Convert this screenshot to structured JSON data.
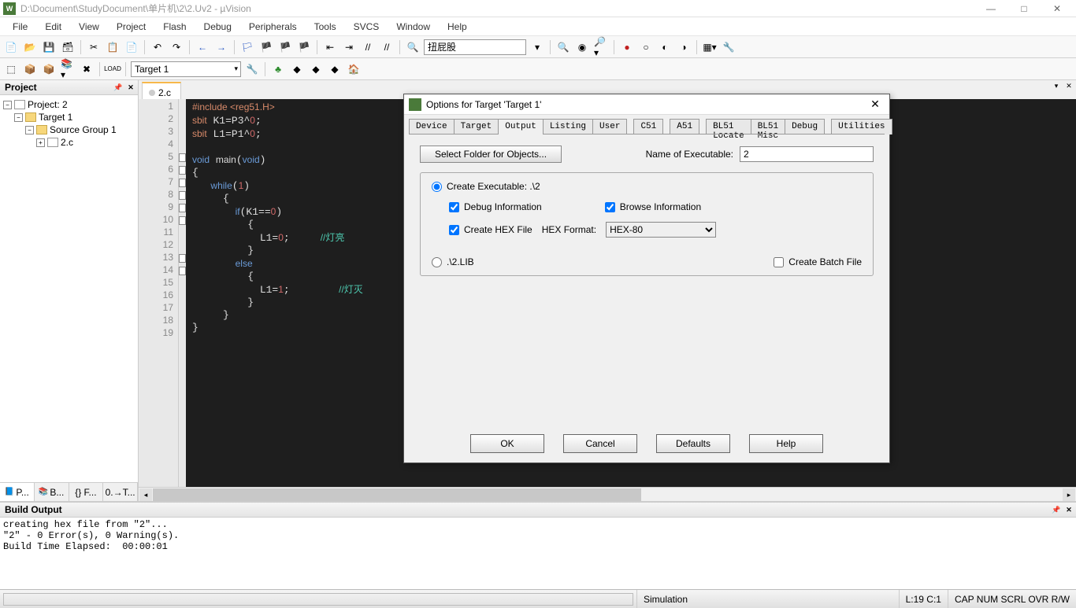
{
  "app": {
    "title": "D:\\Document\\StudyDocument\\单片机\\2\\2.Uv2 - µVision",
    "icon_label": "W"
  },
  "menu": [
    "File",
    "Edit",
    "View",
    "Project",
    "Flash",
    "Debug",
    "Peripherals",
    "Tools",
    "SVCS",
    "Window",
    "Help"
  ],
  "toolbar2": {
    "target": "Target 1"
  },
  "toolbar1": {
    "search": "扭屁股"
  },
  "project": {
    "title": "Project",
    "root": "Project: 2",
    "target": "Target 1",
    "group": "Source Group 1",
    "file": "2.c",
    "tabs": [
      "P...",
      "B...",
      "{} F...",
      "0.→T..."
    ]
  },
  "editor": {
    "tab": "2.c",
    "lines": 19,
    "code_html": "<span class='inc'>#include &lt;reg51.H&gt;</span>\n<span class='sb'>sbit</span> K1=P3^<span class='num'>0</span>;\n<span class='sb'>sbit</span> L1=P1^<span class='num'>0</span>;\n\n<span class='kw'>void</span> <span>main</span>(<span class='kw'>void</span>)\n{\n   <span class='kw'>while</span>(<span class='num'>1</span>)\n     {\n       <span class='kw'>if</span>(K1==<span class='num'>0</span>)\n         {\n           L1=<span class='num'>0</span>;     <span class='cm'>//灯亮</span>\n         }\n       <span class='kw'>else</span>\n         {\n           L1=<span class='num'>1</span>;        <span class='cm'>//灯灭</span>\n         }\n     }\n}\n"
  },
  "build": {
    "title": "Build Output",
    "text": "creating hex file from \"2\"...\n\"2\" - 0 Error(s), 0 Warning(s).\nBuild Time Elapsed:  00:00:01"
  },
  "status": {
    "mode": "Simulation",
    "pos": "L:19 C:1",
    "caps": "CAP NUM SCRL OVR R/W"
  },
  "dialog": {
    "title": "Options for Target 'Target 1'",
    "tabs": [
      "Device",
      "Target",
      "Output",
      "Listing",
      "User",
      "C51",
      "A51",
      "BL51 Locate",
      "BL51 Misc",
      "Debug",
      "Utilities"
    ],
    "active_tab": "Output",
    "select_folder": "Select Folder for Objects...",
    "name_label": "Name of Executable:",
    "name_value": "2",
    "create_exe": "Create Executable:  .\\2",
    "debug_info": "Debug Information",
    "browse_info": "Browse Information",
    "create_hex": "Create HEX File",
    "hex_format_label": "HEX Format:",
    "hex_format": "HEX-80",
    "create_lib": ".\\2.LIB",
    "create_batch": "Create Batch File",
    "buttons": [
      "OK",
      "Cancel",
      "Defaults",
      "Help"
    ]
  }
}
